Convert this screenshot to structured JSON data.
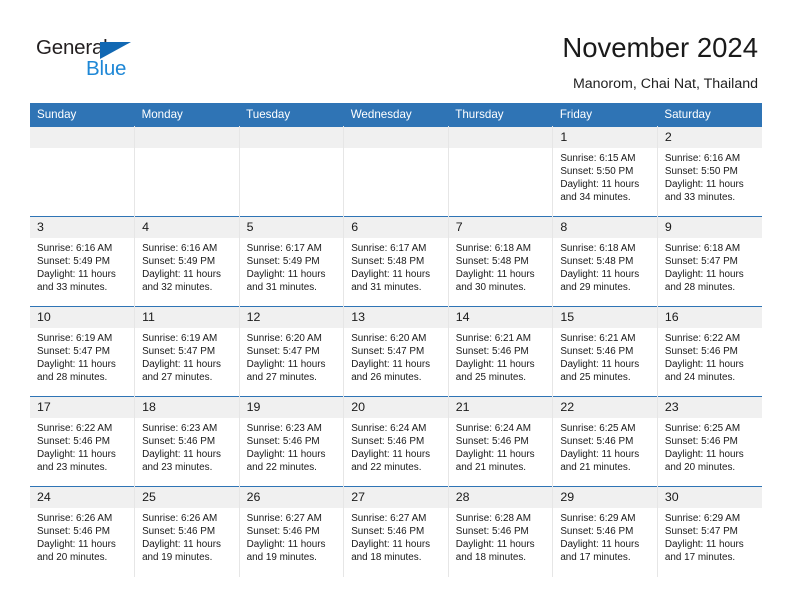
{
  "brand": {
    "name_part1": "General",
    "name_part2": "Blue",
    "accent_color": "#1e87d6",
    "triangle_color": "#1268b3"
  },
  "header": {
    "title": "November 2024",
    "location": "Manorom, Chai Nat, Thailand"
  },
  "calendar": {
    "header_color": "#2f74b5",
    "daynum_bg": "#f0f0f0",
    "weekday_headers": [
      "Sunday",
      "Monday",
      "Tuesday",
      "Wednesday",
      "Thursday",
      "Friday",
      "Saturday"
    ],
    "labels": {
      "sunrise": "Sunrise:",
      "sunset": "Sunset:",
      "daylight": "Daylight:"
    },
    "weeks": [
      [
        {
          "day": "",
          "empty": true
        },
        {
          "day": "",
          "empty": true
        },
        {
          "day": "",
          "empty": true
        },
        {
          "day": "",
          "empty": true
        },
        {
          "day": "",
          "empty": true
        },
        {
          "day": "1",
          "sunrise": "Sunrise: 6:15 AM",
          "sunset": "Sunset: 5:50 PM",
          "daylight": "Daylight: 11 hours and 34 minutes."
        },
        {
          "day": "2",
          "sunrise": "Sunrise: 6:16 AM",
          "sunset": "Sunset: 5:50 PM",
          "daylight": "Daylight: 11 hours and 33 minutes."
        }
      ],
      [
        {
          "day": "3",
          "sunrise": "Sunrise: 6:16 AM",
          "sunset": "Sunset: 5:49 PM",
          "daylight": "Daylight: 11 hours and 33 minutes."
        },
        {
          "day": "4",
          "sunrise": "Sunrise: 6:16 AM",
          "sunset": "Sunset: 5:49 PM",
          "daylight": "Daylight: 11 hours and 32 minutes."
        },
        {
          "day": "5",
          "sunrise": "Sunrise: 6:17 AM",
          "sunset": "Sunset: 5:49 PM",
          "daylight": "Daylight: 11 hours and 31 minutes."
        },
        {
          "day": "6",
          "sunrise": "Sunrise: 6:17 AM",
          "sunset": "Sunset: 5:48 PM",
          "daylight": "Daylight: 11 hours and 31 minutes."
        },
        {
          "day": "7",
          "sunrise": "Sunrise: 6:18 AM",
          "sunset": "Sunset: 5:48 PM",
          "daylight": "Daylight: 11 hours and 30 minutes."
        },
        {
          "day": "8",
          "sunrise": "Sunrise: 6:18 AM",
          "sunset": "Sunset: 5:48 PM",
          "daylight": "Daylight: 11 hours and 29 minutes."
        },
        {
          "day": "9",
          "sunrise": "Sunrise: 6:18 AM",
          "sunset": "Sunset: 5:47 PM",
          "daylight": "Daylight: 11 hours and 28 minutes."
        }
      ],
      [
        {
          "day": "10",
          "sunrise": "Sunrise: 6:19 AM",
          "sunset": "Sunset: 5:47 PM",
          "daylight": "Daylight: 11 hours and 28 minutes."
        },
        {
          "day": "11",
          "sunrise": "Sunrise: 6:19 AM",
          "sunset": "Sunset: 5:47 PM",
          "daylight": "Daylight: 11 hours and 27 minutes."
        },
        {
          "day": "12",
          "sunrise": "Sunrise: 6:20 AM",
          "sunset": "Sunset: 5:47 PM",
          "daylight": "Daylight: 11 hours and 27 minutes."
        },
        {
          "day": "13",
          "sunrise": "Sunrise: 6:20 AM",
          "sunset": "Sunset: 5:47 PM",
          "daylight": "Daylight: 11 hours and 26 minutes."
        },
        {
          "day": "14",
          "sunrise": "Sunrise: 6:21 AM",
          "sunset": "Sunset: 5:46 PM",
          "daylight": "Daylight: 11 hours and 25 minutes."
        },
        {
          "day": "15",
          "sunrise": "Sunrise: 6:21 AM",
          "sunset": "Sunset: 5:46 PM",
          "daylight": "Daylight: 11 hours and 25 minutes."
        },
        {
          "day": "16",
          "sunrise": "Sunrise: 6:22 AM",
          "sunset": "Sunset: 5:46 PM",
          "daylight": "Daylight: 11 hours and 24 minutes."
        }
      ],
      [
        {
          "day": "17",
          "sunrise": "Sunrise: 6:22 AM",
          "sunset": "Sunset: 5:46 PM",
          "daylight": "Daylight: 11 hours and 23 minutes."
        },
        {
          "day": "18",
          "sunrise": "Sunrise: 6:23 AM",
          "sunset": "Sunset: 5:46 PM",
          "daylight": "Daylight: 11 hours and 23 minutes."
        },
        {
          "day": "19",
          "sunrise": "Sunrise: 6:23 AM",
          "sunset": "Sunset: 5:46 PM",
          "daylight": "Daylight: 11 hours and 22 minutes."
        },
        {
          "day": "20",
          "sunrise": "Sunrise: 6:24 AM",
          "sunset": "Sunset: 5:46 PM",
          "daylight": "Daylight: 11 hours and 22 minutes."
        },
        {
          "day": "21",
          "sunrise": "Sunrise: 6:24 AM",
          "sunset": "Sunset: 5:46 PM",
          "daylight": "Daylight: 11 hours and 21 minutes."
        },
        {
          "day": "22",
          "sunrise": "Sunrise: 6:25 AM",
          "sunset": "Sunset: 5:46 PM",
          "daylight": "Daylight: 11 hours and 21 minutes."
        },
        {
          "day": "23",
          "sunrise": "Sunrise: 6:25 AM",
          "sunset": "Sunset: 5:46 PM",
          "daylight": "Daylight: 11 hours and 20 minutes."
        }
      ],
      [
        {
          "day": "24",
          "sunrise": "Sunrise: 6:26 AM",
          "sunset": "Sunset: 5:46 PM",
          "daylight": "Daylight: 11 hours and 20 minutes."
        },
        {
          "day": "25",
          "sunrise": "Sunrise: 6:26 AM",
          "sunset": "Sunset: 5:46 PM",
          "daylight": "Daylight: 11 hours and 19 minutes."
        },
        {
          "day": "26",
          "sunrise": "Sunrise: 6:27 AM",
          "sunset": "Sunset: 5:46 PM",
          "daylight": "Daylight: 11 hours and 19 minutes."
        },
        {
          "day": "27",
          "sunrise": "Sunrise: 6:27 AM",
          "sunset": "Sunset: 5:46 PM",
          "daylight": "Daylight: 11 hours and 18 minutes."
        },
        {
          "day": "28",
          "sunrise": "Sunrise: 6:28 AM",
          "sunset": "Sunset: 5:46 PM",
          "daylight": "Daylight: 11 hours and 18 minutes."
        },
        {
          "day": "29",
          "sunrise": "Sunrise: 6:29 AM",
          "sunset": "Sunset: 5:46 PM",
          "daylight": "Daylight: 11 hours and 17 minutes."
        },
        {
          "day": "30",
          "sunrise": "Sunrise: 6:29 AM",
          "sunset": "Sunset: 5:47 PM",
          "daylight": "Daylight: 11 hours and 17 minutes."
        }
      ]
    ]
  }
}
